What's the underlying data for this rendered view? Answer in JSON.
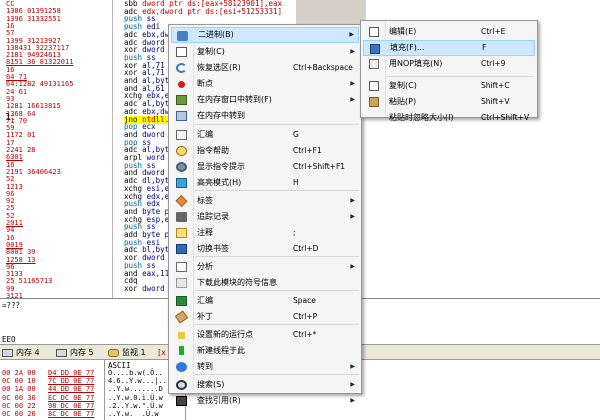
{
  "disasm": {
    "left_column": [
      "CC",
      "1386 01391258",
      "1396 31332551",
      "16",
      "57",
      "1399 31213927",
      "138431 32237117",
      "2181 94924613",
      "8151 36 81322011",
      "16",
      "64 71",
      "64:1282 49131165",
      "24 61",
      "93",
      "1281 16613815",
      "1368 64",
      "71 70",
      "59",
      "1172 01",
      "17",
      "2241 28",
      "6301",
      "16",
      "2191 36406423",
      "52",
      "1213",
      "96",
      "92",
      "25",
      "52",
      "2011",
      "94",
      "16",
      "0019",
      "8001 39",
      "1258 13",
      "96",
      "3133",
      "25 51165713",
      "99",
      "3121"
    ],
    "code_lines": [
      {
        "op": "sbb",
        "args": "dword ptr ds:[eax+58123901],eax"
      },
      {
        "op": "adc",
        "args": "edx,dword ptr ds:[esi+51253331]"
      },
      {
        "op": "push",
        "args": "ss"
      },
      {
        "op": "push",
        "args": "edi"
      },
      {
        "op": "adc",
        "args": "ebx,dw"
      },
      {
        "op": "adc",
        "args": "dword"
      },
      {
        "op": "xor",
        "args": "dword"
      },
      {
        "op": "push",
        "args": "ss"
      },
      {
        "op": "xor",
        "args": "al,71"
      },
      {
        "op": "xor",
        "args": "al,71"
      },
      {
        "op": "and",
        "args": "al,byt"
      },
      {
        "op": "and",
        "args": "al,61"
      },
      {
        "op": "xchg",
        "args": "ebx,e"
      },
      {
        "op": "adc",
        "args": "al,byt"
      },
      {
        "op": "adc",
        "args": "ebx,dw"
      },
      {
        "op": "jno",
        "args": "ntdll."
      },
      {
        "op": "pop",
        "args": "ecx"
      },
      {
        "op": "and",
        "args": "dword"
      },
      {
        "op": "pop",
        "args": "ss"
      },
      {
        "op": "adc",
        "args": "al,byt"
      },
      {
        "op": "arpl",
        "args": "word"
      },
      {
        "op": "push",
        "args": "ss"
      },
      {
        "op": "and",
        "args": "dword"
      },
      {
        "op": "adc",
        "args": "dl,byt"
      },
      {
        "op": "xchg",
        "args": "esi,e"
      },
      {
        "op": "xchg",
        "args": "edx,e"
      },
      {
        "op": "push",
        "args": "edx"
      },
      {
        "op": "and",
        "args": "byte p"
      },
      {
        "op": "xchg",
        "args": "esp,e"
      },
      {
        "op": "push",
        "args": "ss"
      },
      {
        "op": "add",
        "args": "byte p"
      },
      {
        "op": "push",
        "args": "esi"
      },
      {
        "op": "adc",
        "args": "bl,byt"
      },
      {
        "op": "xor",
        "args": "dword"
      },
      {
        "op": "push",
        "args": "ss"
      },
      {
        "op": "and",
        "args": "eax,11"
      },
      {
        "op": "cdq",
        "args": ""
      },
      {
        "op": "xor",
        "args": "dword"
      }
    ],
    "marker": "1:"
  },
  "info": {
    "line1": "=???",
    "line2": "EEO"
  },
  "tabs": [
    {
      "label": "内存 4"
    },
    {
      "label": "内存 5"
    },
    {
      "label": "监视 1"
    },
    {
      "label": "[x"
    }
  ],
  "dump": {
    "header": "ASCII",
    "rows": [
      {
        "addr": "00 2A 00",
        "hex": "D4 DD 0E 77",
        "ascii": "Ò....b.w(.Ô.."
      },
      {
        "addr": "0C 00 10",
        "hex": "7C DD 0E 77",
        "ascii": "4.6..Y.w...|.."
      },
      {
        "addr": "00 1A 00",
        "hex": "44 DD 0E 77",
        "ascii": "..Y.w.......D"
      },
      {
        "addr": "0C 00 30",
        "hex": "EC DC 0E 77",
        "ascii": "..Y.w.0.ì.Ü.w"
      },
      {
        "addr": "0C 00 22",
        "hex": "98 DC 0E 77",
        "ascii": ".2..Y.w.\".Ü.w"
      },
      {
        "addr": "0C 00 20",
        "hex": "8C DC 0E 77",
        "ascii": "..Y.w.  .Ü.w"
      }
    ]
  },
  "context_menu": {
    "items": [
      {
        "label": "二进制(B)",
        "shortcut": "",
        "submenu": true,
        "icon": "binary-icon",
        "selected": true
      },
      {
        "label": "复制(C)",
        "shortcut": "",
        "submenu": true,
        "icon": "copy-icon"
      },
      {
        "label": "恢复选区(R)",
        "shortcut": "Ctrl+Backspace",
        "submenu": false,
        "icon": "undo-icon"
      },
      {
        "label": "断点",
        "shortcut": "",
        "submenu": true,
        "icon": "breakpoint-icon"
      },
      {
        "label": "在内存窗口中转到(F)",
        "shortcut": "",
        "submenu": true,
        "icon": "memory-goto-icon"
      },
      {
        "label": "在内存中转到",
        "shortcut": "",
        "submenu": false,
        "icon": "window-icon"
      },
      {
        "label": "汇编",
        "shortcut": "G",
        "submenu": false,
        "icon": "assemble-icon"
      },
      {
        "label": "指令帮助",
        "shortcut": "Ctrl+F1",
        "submenu": false,
        "icon": "help-icon"
      },
      {
        "label": "显示指令提示",
        "shortcut": "Ctrl+Shift+F1",
        "submenu": false,
        "icon": "cog-icon"
      },
      {
        "label": "高亮模式(H)",
        "shortcut": "H",
        "submenu": false,
        "icon": "highlight-icon"
      },
      {
        "label": "标签",
        "shortcut": "",
        "submenu": true,
        "icon": "tag-icon"
      },
      {
        "label": "追踪记录",
        "shortcut": "",
        "submenu": true,
        "icon": "trace-icon"
      },
      {
        "label": "注释",
        "shortcut": ";",
        "submenu": false,
        "icon": "comment-icon"
      },
      {
        "label": "切换书签",
        "shortcut": "Ctrl+D",
        "submenu": false,
        "icon": "bookmark-icon"
      },
      {
        "label": "分析",
        "shortcut": "",
        "submenu": true,
        "icon": "analysis-icon"
      },
      {
        "label": "下载此模块的符号信息",
        "shortcut": "",
        "submenu": false,
        "icon": "symbol-icon"
      },
      {
        "label": "汇编",
        "shortcut": "Space",
        "submenu": false,
        "icon": "assembler-icon"
      },
      {
        "label": "补丁",
        "shortcut": "Ctrl+P",
        "submenu": false,
        "icon": "patch-icon"
      },
      {
        "label": "设置新的运行点",
        "shortcut": "Ctrl+*",
        "submenu": false,
        "icon": "eip-icon"
      },
      {
        "label": "新建线程于此",
        "shortcut": "",
        "submenu": false,
        "icon": "thread-icon"
      },
      {
        "label": "转到",
        "shortcut": "",
        "submenu": true,
        "icon": "goto-icon"
      },
      {
        "label": "搜索(S)",
        "shortcut": "",
        "submenu": true,
        "icon": "search-icon"
      },
      {
        "label": "查找引用(R)",
        "shortcut": "",
        "submenu": true,
        "icon": "references-icon"
      }
    ]
  },
  "submenu": {
    "items": [
      {
        "label": "编辑(E)",
        "shortcut": "Ctrl+E",
        "icon": "edit-icon"
      },
      {
        "label": "填充(F)...",
        "shortcut": "F",
        "icon": "fill-icon",
        "selected": true
      },
      {
        "label": "用NOP填充(N)",
        "shortcut": "Ctrl+9",
        "icon": "nop-icon"
      },
      {
        "label": "复制(C)",
        "shortcut": "Shift+C",
        "icon": "copy-icon"
      },
      {
        "label": "粘贴(P)",
        "shortcut": "Shift+V",
        "icon": "paste-icon"
      },
      {
        "label": "粘贴时忽略大小(I)",
        "shortcut": "Ctrl+Shift+V",
        "icon": "paste-ignore-icon"
      }
    ]
  }
}
